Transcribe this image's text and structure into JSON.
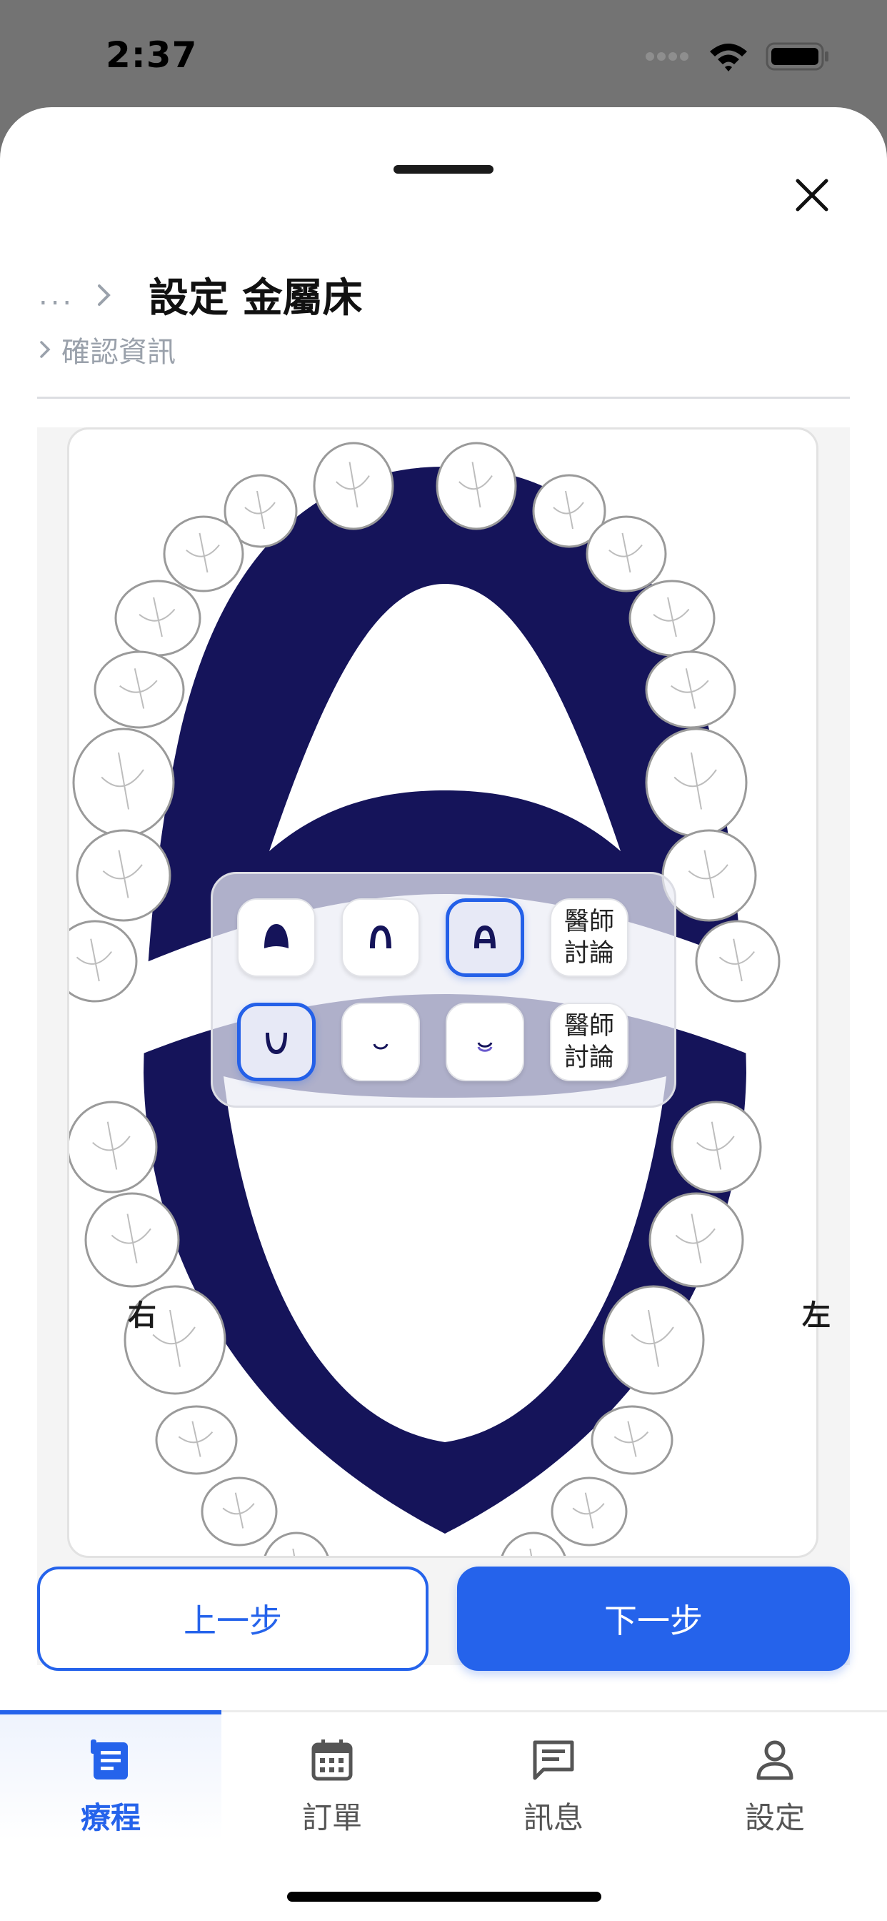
{
  "status_bar": {
    "time": "2:37"
  },
  "header": {
    "breadcrumb_ellipsis": "...",
    "title": "設定 金屬床",
    "subtitle": "確認資訊"
  },
  "chart": {
    "right_label": "右",
    "left_label": "左",
    "palate_color": "#15145a"
  },
  "options": {
    "upper": [
      {
        "icon": "upper-full-palate-icon",
        "selected": false
      },
      {
        "icon": "upper-horseshoe-icon",
        "selected": false
      },
      {
        "icon": "upper-ap-strap-icon",
        "selected": true
      },
      {
        "label": "醫師討論",
        "selected": false
      }
    ],
    "lower": [
      {
        "icon": "lower-lingual-plate-icon",
        "selected": true
      },
      {
        "icon": "lower-lingual-bar-icon",
        "selected": false
      },
      {
        "icon": "lower-double-bar-icon",
        "selected": false
      },
      {
        "label": "醫師討論",
        "selected": false
      }
    ]
  },
  "buttons": {
    "prev": "上一步",
    "next": "下一步"
  },
  "colors": {
    "accent": "#2563eb"
  },
  "tabbar": {
    "items": [
      {
        "label": "療程",
        "icon": "treatment-icon",
        "active": true
      },
      {
        "label": "訂單",
        "icon": "calendar-icon",
        "active": false
      },
      {
        "label": "訊息",
        "icon": "message-icon",
        "active": false
      },
      {
        "label": "設定",
        "icon": "person-icon",
        "active": false
      }
    ]
  }
}
